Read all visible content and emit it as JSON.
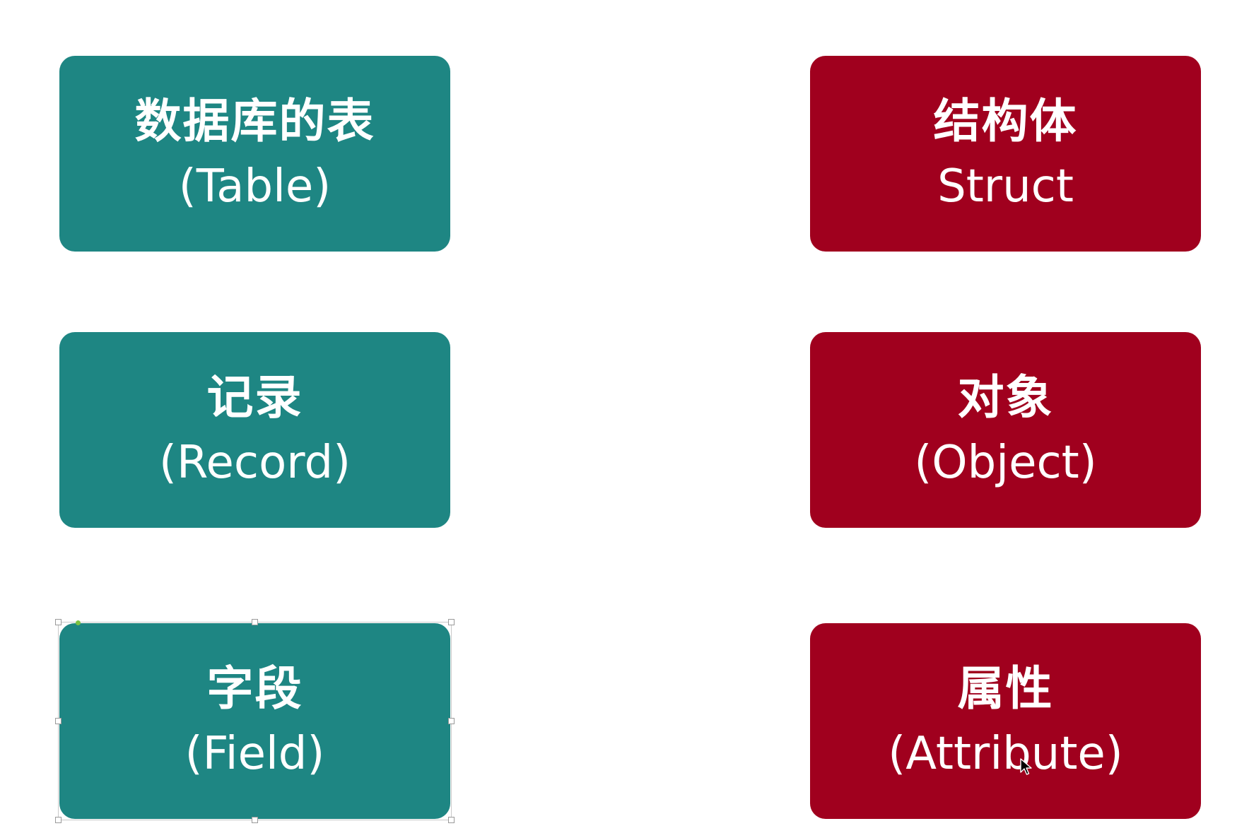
{
  "colors": {
    "teal": "#1e8683",
    "red": "#a0001e",
    "text": "#ffffff",
    "background": "#ffffff"
  },
  "left_column": [
    {
      "zh": "数据库的表",
      "en": "(Table)"
    },
    {
      "zh": "记录",
      "en": "(Record)"
    },
    {
      "zh": "字段",
      "en": "(Field)"
    }
  ],
  "right_column": [
    {
      "zh": "结构体",
      "en": "Struct"
    },
    {
      "zh": "对象",
      "en": "(Object)"
    },
    {
      "zh": "属性",
      "en": "(Attribute)"
    }
  ],
  "cursor_icon": "arrow-cursor-icon"
}
